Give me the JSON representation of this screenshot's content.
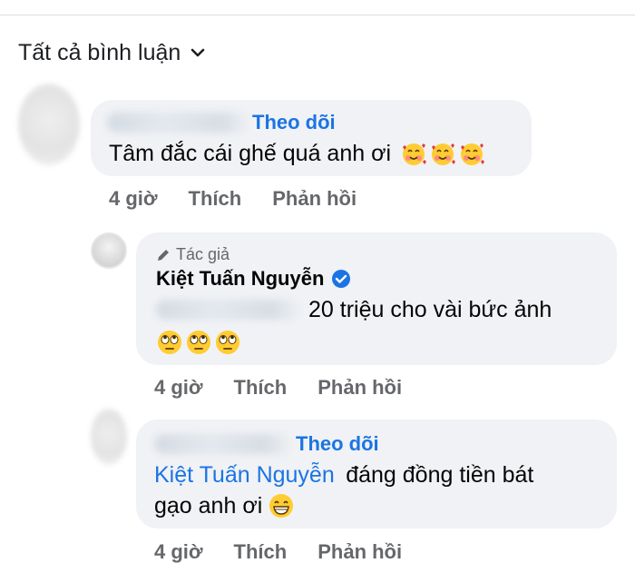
{
  "header": {
    "sort_label": "Tất cả bình luận"
  },
  "comments": [
    {
      "follow_label": "Theo dõi",
      "text": "Tâm đắc cái ghế quá anh ơi",
      "emoji": [
        "smiling-face-with-hearts",
        "smiling-face-with-hearts",
        "smiling-face-with-hearts"
      ],
      "time": "4 giờ",
      "like_label": "Thích",
      "reply_label": "Phản hồi"
    },
    {
      "author_badge": "Tác giả",
      "name": "Kiệt Tuấn Nguyễn",
      "text": "20 triệu cho vài bức ảnh",
      "emoji": [
        "face-with-rolling-eyes",
        "face-with-rolling-eyes",
        "face-with-rolling-eyes"
      ],
      "time": "4 giờ",
      "like_label": "Thích",
      "reply_label": "Phản hồi"
    },
    {
      "follow_label": "Theo dõi",
      "mention": "Kiệt Tuấn Nguyễn",
      "text_line1": "đáng đồng tiền bát",
      "text_line2": "gạo anh ơi",
      "emoji": [
        "grinning-face-with-smiling-eyes"
      ],
      "time": "4 giờ",
      "like_label": "Thích",
      "reply_label": "Phản hồi"
    }
  ],
  "colors": {
    "link": "#1b74e4",
    "bubble": "#f0f2f5",
    "meta": "#65676b",
    "verified": "#1b74e4"
  }
}
